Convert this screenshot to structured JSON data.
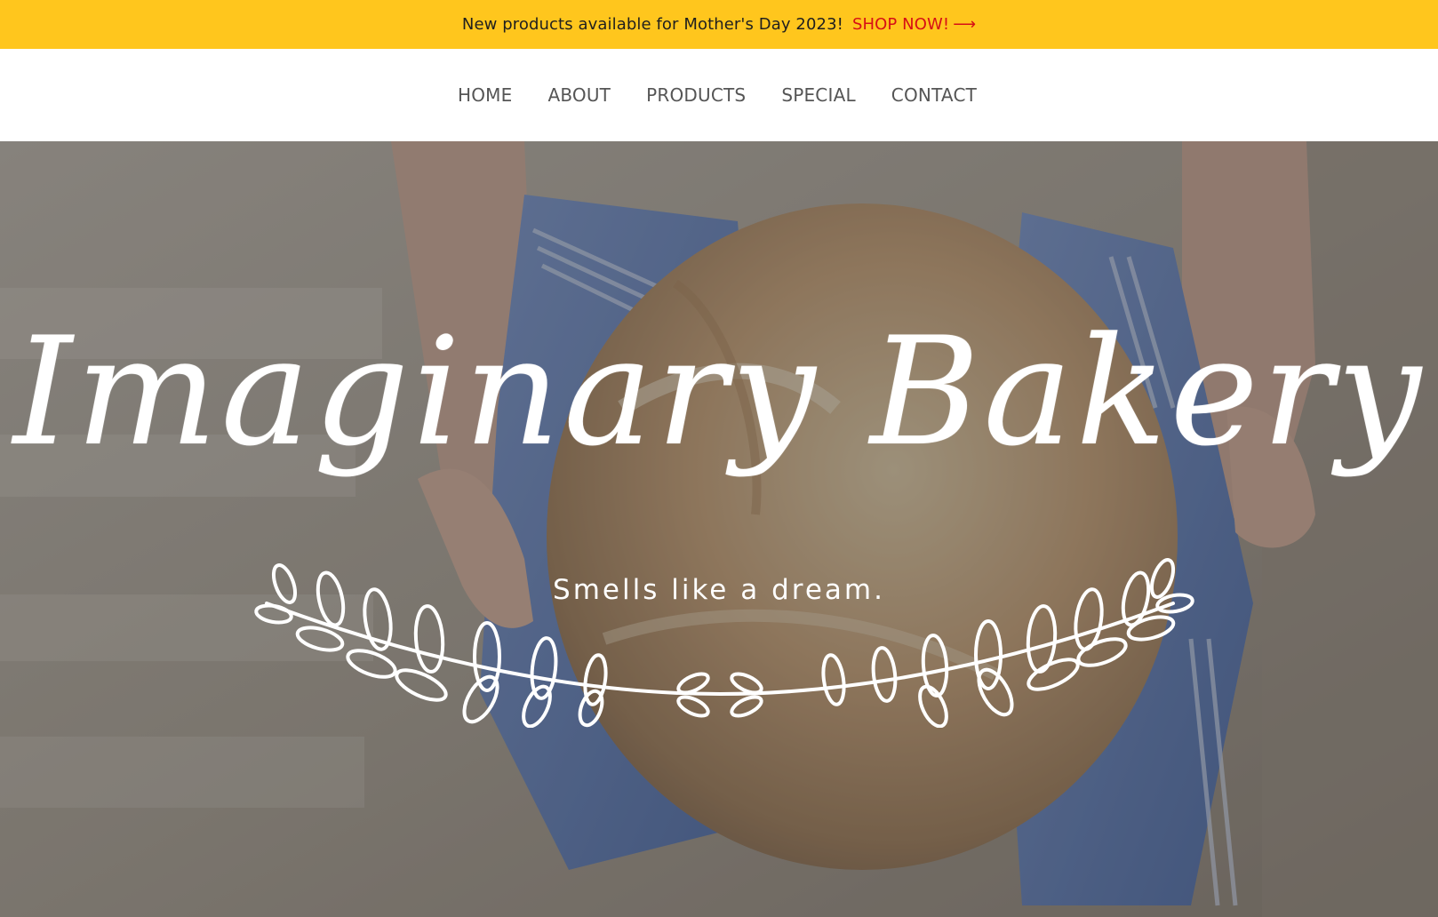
{
  "announcement": {
    "message": "New products available for Mother's Day 2023!",
    "cta_label": "SHOP NOW!",
    "cta_arrow": "⟶",
    "background_color": "#ffc61d",
    "cta_color": "#d60f16"
  },
  "nav": {
    "items": [
      {
        "label": "HOME"
      },
      {
        "label": "ABOUT"
      },
      {
        "label": "PRODUCTS"
      },
      {
        "label": "SPECIAL"
      },
      {
        "label": "CONTACT"
      }
    ]
  },
  "hero": {
    "title": "Imaginary Bakery",
    "tagline": "Smells like a dream.",
    "image_icon": "bread-in-hands-photo",
    "decoration_icon": "laurel-wreath-icon"
  }
}
